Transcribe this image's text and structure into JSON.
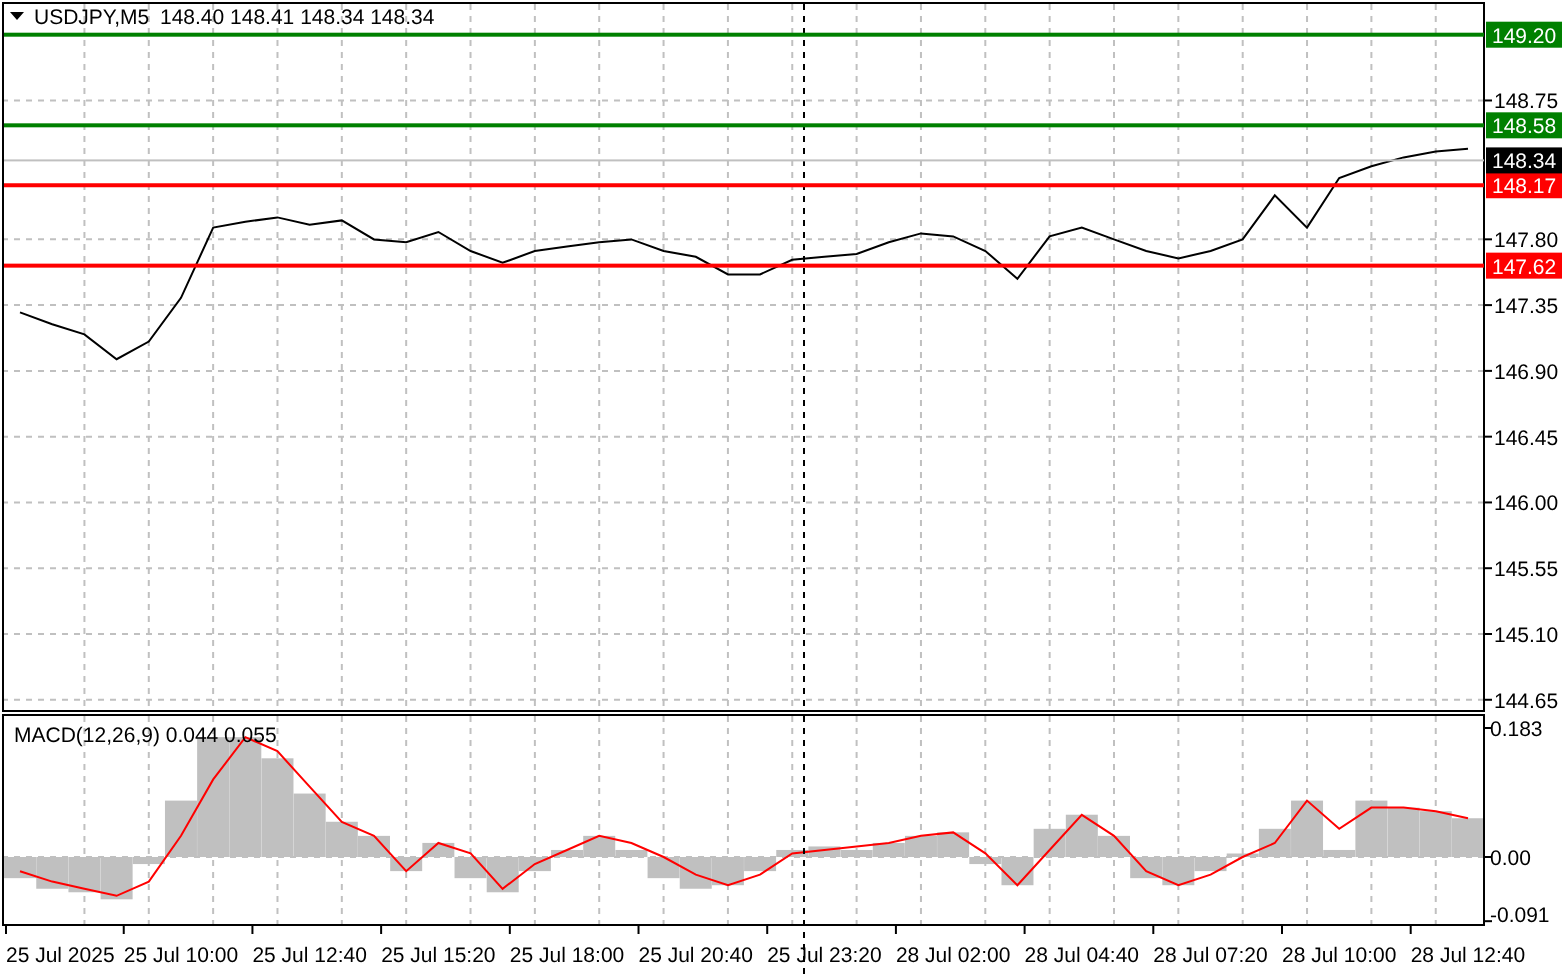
{
  "header": {
    "symbol": "USDJPY,M5",
    "ohlc": "148.40 148.41 148.34 148.34"
  },
  "main_chart": {
    "chart_data": {
      "type": "line",
      "grid": true,
      "ylim": [
        144.58,
        149.41
      ],
      "categories": [
        null,
        null,
        null,
        null,
        null,
        null,
        null,
        null,
        null,
        null,
        null,
        null,
        null,
        null,
        null,
        null,
        null,
        null,
        null,
        null,
        null,
        null,
        null,
        null,
        null,
        null,
        null,
        null,
        null,
        null,
        null,
        null,
        null,
        null,
        null,
        null,
        null,
        null,
        null,
        null,
        null,
        null,
        null,
        null,
        null,
        null
      ],
      "yticks": [
        {
          "value": 148.75,
          "label": "148.75"
        },
        {
          "value": 147.8,
          "label": "147.80"
        },
        {
          "value": 147.35,
          "label": "147.35"
        },
        {
          "value": 146.9,
          "label": "146.90"
        },
        {
          "value": 146.45,
          "label": "146.45"
        },
        {
          "value": 146.0,
          "label": "146.00"
        },
        {
          "value": 145.55,
          "label": "145.55"
        },
        {
          "value": 145.1,
          "label": "145.10"
        },
        {
          "value": 144.65,
          "label": "144.65"
        }
      ],
      "series": [
        {
          "color": "#000000",
          "values": [
            147.3,
            147.22,
            147.15,
            146.98,
            147.1,
            147.4,
            147.88,
            147.92,
            147.95,
            147.9,
            147.93,
            147.8,
            147.78,
            147.85,
            147.72,
            147.64,
            147.72,
            147.75,
            147.78,
            147.8,
            147.72,
            147.68,
            147.56,
            147.56,
            147.66,
            147.68,
            147.7,
            147.78,
            147.84,
            147.82,
            147.72,
            147.53,
            147.82,
            147.88,
            147.8,
            147.72,
            147.67,
            147.72,
            147.8,
            148.1,
            147.88,
            148.22,
            148.3,
            148.36,
            148.4,
            148.42
          ]
        }
      ]
    },
    "levels": [
      {
        "label": "149.20",
        "color": "#008000"
      },
      {
        "label": "148.58",
        "color": "#008000"
      },
      {
        "label": "148.17",
        "color": "#ff0000"
      },
      {
        "label": "147.62",
        "color": "#ff0000"
      }
    ],
    "current_price": {
      "label": "148.34"
    }
  },
  "macd": {
    "title": "MACD(12,26,9) 0.044 0.055",
    "chart_data": {
      "type": "bar",
      "grid": true,
      "ylim": [
        -0.095,
        0.2
      ],
      "categories": [
        null,
        "25 Jul 2025",
        null,
        null,
        null,
        "25 Jul 10:00",
        null,
        null,
        null,
        "25 Jul 12:40",
        null,
        null,
        null,
        "25 Jul 15:20",
        null,
        null,
        null,
        "25 Jul 18:00",
        null,
        null,
        null,
        "25 Jul 20:40",
        null,
        null,
        null,
        "25 Jul 23:20",
        null,
        null,
        null,
        "28 Jul 02:00",
        null,
        null,
        null,
        "28 Jul 04:40",
        null,
        null,
        null,
        "28 Jul 07:20",
        null,
        null,
        null,
        "28 Jul 10:00",
        null,
        null,
        null,
        "28 Jul 12:40"
      ],
      "yticks": [
        {
          "value": 0.183,
          "label": "0.183"
        },
        {
          "value": 0,
          "label": "0.00"
        },
        {
          "value": -0.091,
          "label": "-0.091"
        }
      ],
      "series": [
        {
          "type": "bar",
          "color": "#c0c0c0",
          "values": [
            -0.03,
            -0.045,
            -0.05,
            -0.06,
            -0.01,
            0.08,
            0.17,
            0.17,
            0.14,
            0.09,
            0.05,
            0.03,
            -0.02,
            0.02,
            -0.03,
            -0.05,
            -0.02,
            0.01,
            0.03,
            0.01,
            -0.03,
            -0.045,
            -0.04,
            -0.02,
            0.01,
            0.015,
            0.01,
            0.02,
            0.03,
            0.035,
            -0.01,
            -0.04,
            0.04,
            0.06,
            0.03,
            -0.03,
            -0.04,
            -0.02,
            0.005,
            0.04,
            0.08,
            0.01,
            0.08,
            0.07,
            0.065,
            0.055
          ]
        },
        {
          "type": "line",
          "color": "#ff0000",
          "values": [
            -0.02,
            -0.035,
            -0.045,
            -0.055,
            -0.035,
            0.03,
            0.11,
            0.17,
            0.15,
            0.1,
            0.05,
            0.03,
            -0.02,
            0.02,
            0.005,
            -0.045,
            -0.01,
            0.01,
            0.03,
            0.02,
            0,
            -0.025,
            -0.04,
            -0.025,
            0.005,
            0.01,
            0.015,
            0.02,
            0.03,
            0.035,
            0.005,
            -0.04,
            0.01,
            0.06,
            0.03,
            -0.02,
            -0.04,
            -0.025,
            0,
            0.02,
            0.08,
            0.04,
            0.07,
            0.07,
            0.065,
            0.055
          ]
        }
      ]
    }
  }
}
